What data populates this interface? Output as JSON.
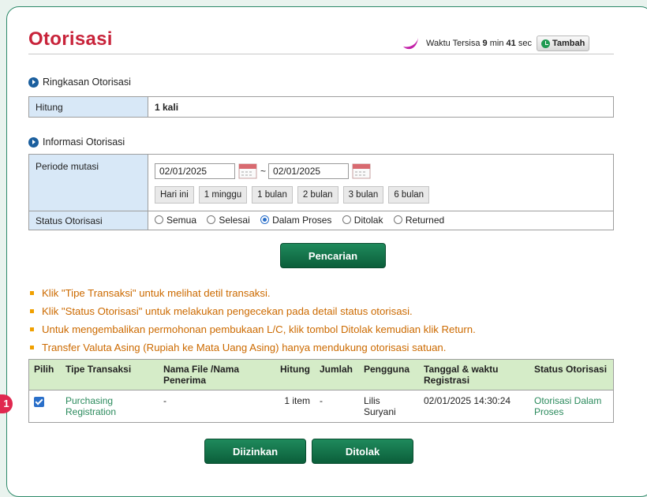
{
  "page": {
    "title": "Otorisasi",
    "badge_number": "1"
  },
  "timer": {
    "prefix": "Waktu Tersisa",
    "minutes": "9",
    "min_label": "min",
    "seconds": "41",
    "sec_label": "sec",
    "extend_label": "Tambah"
  },
  "summary": {
    "heading": "Ringkasan Otorisasi",
    "count_label": "Hitung",
    "count_value": "1 kali"
  },
  "info": {
    "heading": "Informasi Otorisasi",
    "period_label": "Periode mutasi",
    "date_from": "02/01/2025",
    "date_sep": "~",
    "date_to": "02/01/2025",
    "quick_ranges": [
      "Hari ini",
      "1 minggu",
      "1 bulan",
      "2 bulan",
      "3 bulan",
      "6 bulan"
    ],
    "status_label": "Status Otorisasi",
    "status_options": [
      "Semua",
      "Selesai",
      "Dalam Proses",
      "Ditolak",
      "Returned"
    ],
    "status_selected": "Dalam Proses"
  },
  "search_button": "Pencarian",
  "notes": [
    "Klik \"Tipe Transaksi\" untuk melihat detil transaksi.",
    "Klik \"Status Otorisasi\" untuk melakukan pengecekan pada detail status otorisasi.",
    "Untuk mengembalikan permohonan pembukaan L/C, klik tombol Ditolak kemudian klik Return.",
    "Transfer Valuta Asing (Rupiah ke Mata Uang Asing) hanya mendukung otorisasi satuan."
  ],
  "table": {
    "headers": [
      "Pilih",
      "Tipe Transaksi",
      "Nama File /Nama Penerima",
      "Hitung",
      "Jumlah",
      "Pengguna",
      "Tanggal & waktu Registrasi",
      "Status Otorisasi"
    ],
    "rows": [
      {
        "checked": true,
        "type": "Purchasing Registration",
        "name": "-",
        "count": "1 item",
        "amount": "-",
        "user": "Lilis Suryani",
        "datetime": "02/01/2025 14:30:24",
        "status": "Otorisasi Dalam Proses"
      }
    ]
  },
  "actions": {
    "approve": "Diizinkan",
    "reject": "Ditolak"
  },
  "colors": {
    "title": "#c8233a",
    "accent_green": "#1f7a52",
    "note_orange": "#cc6a00",
    "label_blue": "#d8e8f7",
    "header_green": "#d5ecc8"
  }
}
